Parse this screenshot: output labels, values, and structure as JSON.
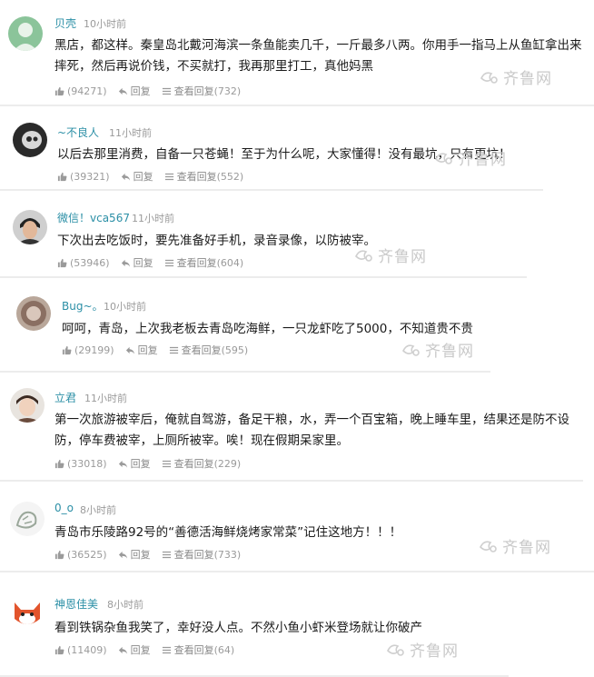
{
  "labels": {
    "reply": "回复",
    "view_replies": "查看回复"
  },
  "watermark": "齐鲁网",
  "comments": [
    {
      "user": "贝壳",
      "time": "10小时前",
      "text": "黑店，都这样。秦皇岛北戴河海滨一条鱼能卖几千，一斤最多八两。你用手一指马上从鱼缸拿出来摔死，然后再说价钱，不买就打，我再那里打工，真他妈黑",
      "likes": "(94271)",
      "replies": "(732)"
    },
    {
      "user": "~不良人",
      "time": "11小时前",
      "text": "以后去那里消费，自备一只苍蝇！至于为什么呢，大家懂得！没有最坑，只有更坑！",
      "likes": "(39321)",
      "replies": "(552)"
    },
    {
      "user": "微信！vca567",
      "time": "11小时前",
      "text": "下次出去吃饭时，要先准备好手机，录音录像，以防被宰。",
      "likes": "(53946)",
      "replies": "(604)"
    },
    {
      "user": "Bug~。",
      "time": "10小时前",
      "text": "呵呵，青岛，上次我老板去青岛吃海鲜，一只龙虾吃了5000，不知道贵不贵",
      "likes": "(29199)",
      "replies": "(595)"
    },
    {
      "user": "立君",
      "time": "11小时前",
      "text": "第一次旅游被宰后，俺就自驾游，备足干粮，水，弄一个百宝箱，晚上睡车里，结果还是防不设防，停车费被宰，上厕所被宰。唉！现在假期呆家里。",
      "likes": "(33018)",
      "replies": "(229)"
    },
    {
      "user": "0_o",
      "time": "8小时前",
      "text": "青岛市乐陵路92号的“善德活海鲜烧烤家常菜”记住这地方！！！",
      "likes": "(36525)",
      "replies": "(733)"
    },
    {
      "user": "神恩佳美",
      "time": "8小时前",
      "text": "看到铁锅杂鱼我笑了，幸好没人点。不然小鱼小虾米登场就让你破产",
      "likes": "(11409)",
      "replies": "(64)"
    }
  ]
}
